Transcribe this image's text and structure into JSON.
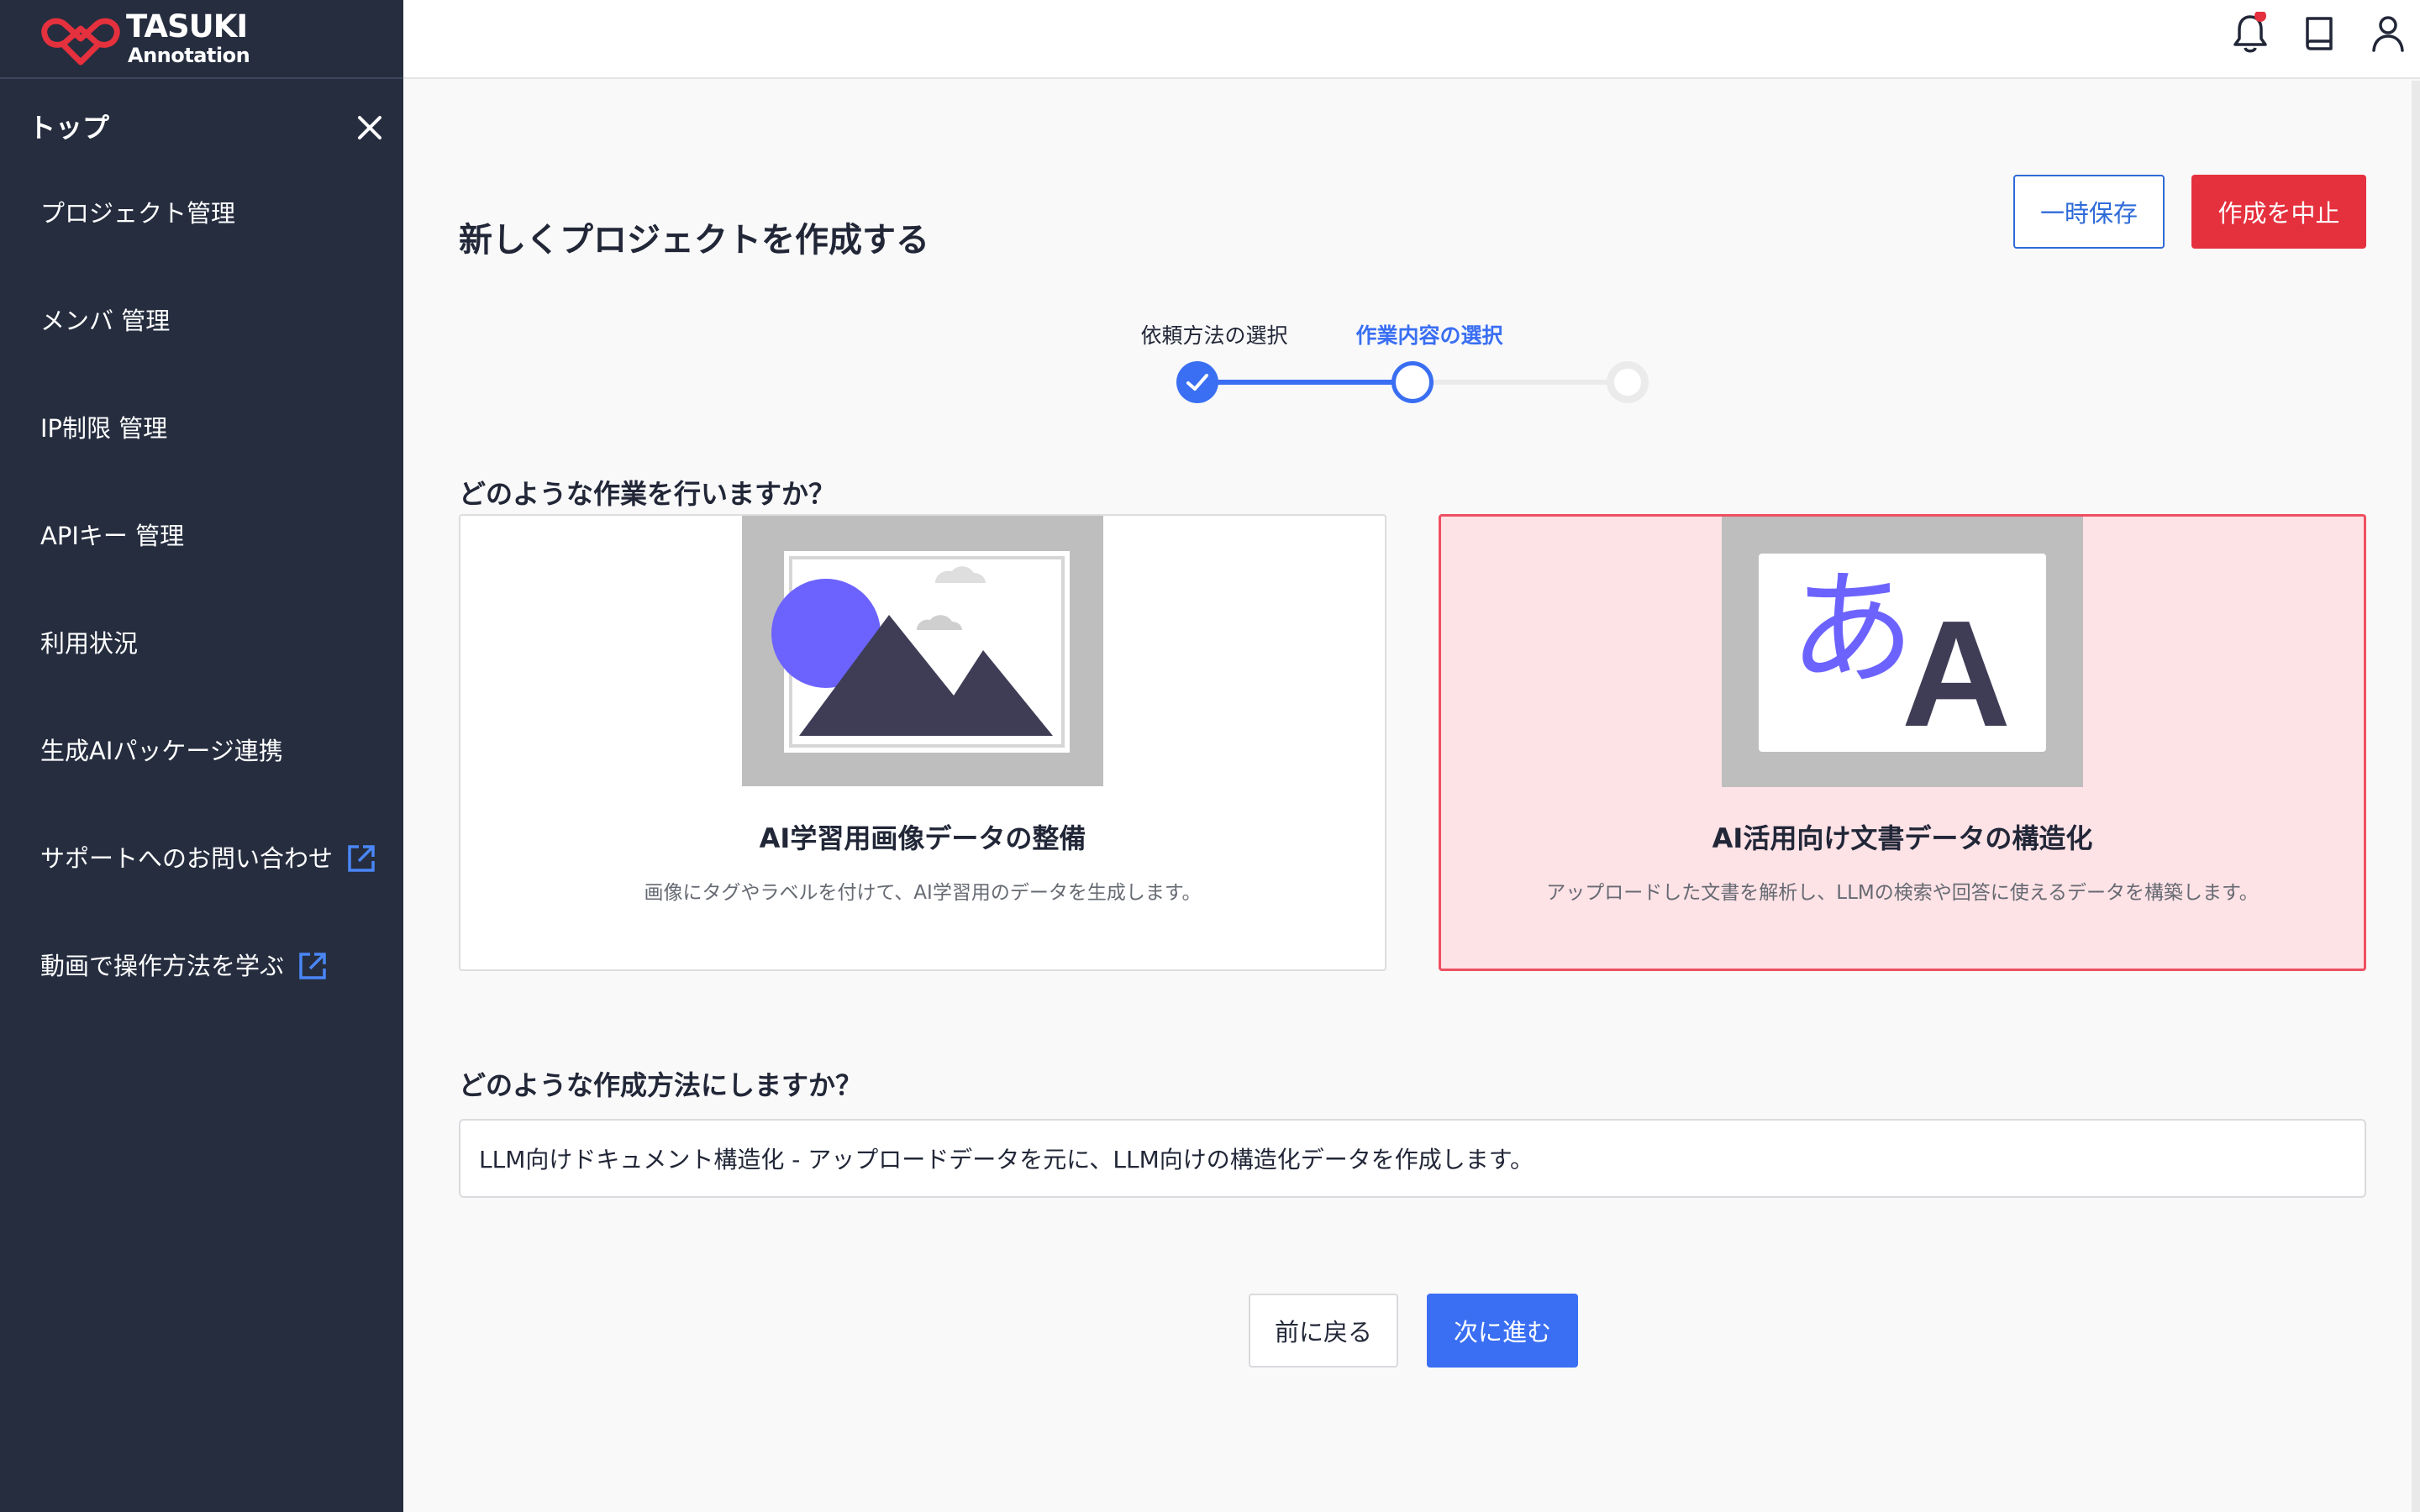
{
  "brand": {
    "name": "TASUKI",
    "sub": "Annotation",
    "color": "#e5303d"
  },
  "sidebar": {
    "top_label": "トップ",
    "items": [
      {
        "label": "プロジェクト管理"
      },
      {
        "label": "メンバ 管理"
      },
      {
        "label": "IP制限 管理"
      },
      {
        "label": "APIキー 管理"
      },
      {
        "label": "利用状況"
      },
      {
        "label": "生成AIパッケージ連携"
      },
      {
        "label": "サポートへのお問い合わせ",
        "icon": "external-link-icon"
      },
      {
        "label": "動画で操作方法を学ぶ",
        "icon": "external-link-icon"
      }
    ]
  },
  "header": {
    "icons": [
      "bell-icon",
      "book-icon",
      "user-icon"
    ],
    "notification_dot_color": "#e5303d"
  },
  "main": {
    "title": "新しくプロジェクトを作成する",
    "save_label": "一時保存",
    "cancel_label": "作成を中止",
    "steps": [
      {
        "label": "依頼方法の選択",
        "state": "done"
      },
      {
        "label": "作業内容の選択",
        "state": "current"
      },
      {
        "label": "",
        "state": "pending"
      }
    ],
    "question1": "どのような作業を行いますか？",
    "cards": [
      {
        "title": "AI学習用画像データの整備",
        "desc": "画像にタグやラベルを付けて、AI学習用のデータを生成します。",
        "icon": "image-icon",
        "selected": false
      },
      {
        "title": "AI活用向け文書データの構造化",
        "desc": "アップロードした文書を解析し、LLMの検索や回答に使えるデータを構築します。",
        "icon": "text-icon",
        "glyph_ja": "あ",
        "glyph_en": "A",
        "selected": true
      }
    ],
    "question2": "どのような作成方法にしますか？",
    "method_value": "LLM向けドキュメント構造化 - アップロードデータを元に、LLM向けの構造化データを作成します。",
    "back_label": "前に戻る",
    "next_label": "次に進む"
  },
  "colors": {
    "accent": "#3a6ff3",
    "danger": "#e5303d",
    "sidebar": "#252d3f",
    "selected_card_bg": "#fde2e6",
    "illustration_purple": "#6c63ff",
    "illustration_dark": "#3f3d56"
  }
}
